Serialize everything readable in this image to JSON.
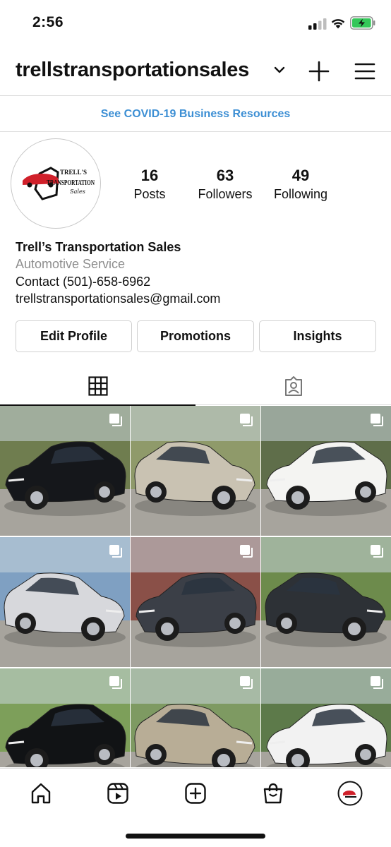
{
  "status_bar": {
    "time": "2:56"
  },
  "header": {
    "username": "trellstransportationsales"
  },
  "banner": {
    "text": "See COVID-19 Business Resources"
  },
  "profile": {
    "stats": [
      {
        "value": "16",
        "label": "Posts"
      },
      {
        "value": "63",
        "label": "Followers"
      },
      {
        "value": "49",
        "label": "Following"
      }
    ],
    "name": "Trell’s Transportation Sales",
    "category": "Automotive Service",
    "contact": "Contact (501)-658-6962",
    "email": "trellstransportationsales@gmail.com",
    "logo_text": {
      "line1": "TRELL'S",
      "line2": "TRANSPORTATION",
      "line3": "Sales"
    }
  },
  "buttons": {
    "edit": "Edit Profile",
    "promotions": "Promotions",
    "insights": "Insights"
  },
  "posts": [
    {
      "car": "black sedan",
      "body": "#15171b",
      "bg": "#6f7d4f"
    },
    {
      "car": "silver sedan",
      "body": "#c9c2b2",
      "bg": "#8f9a6a"
    },
    {
      "car": "white sedan",
      "body": "#f4f4f2",
      "bg": "#5f6e4a"
    },
    {
      "car": "silver sedan",
      "body": "#d7d8dc",
      "bg": "#7fa0c2"
    },
    {
      "car": "gray sedan",
      "body": "#3b3f47",
      "bg": "#8a5048"
    },
    {
      "car": "gray sedan",
      "body": "#2d3136",
      "bg": "#6d8b4c"
    },
    {
      "car": "black sedan",
      "body": "#111315",
      "bg": "#7d9f5a"
    },
    {
      "car": "gold sedan",
      "body": "#b8ad96",
      "bg": "#7e9a62"
    },
    {
      "car": "white sedan",
      "body": "#f2f2f2",
      "bg": "#5d7a4a"
    }
  ],
  "colors": {
    "link": "#3d8fd4",
    "secondary_text": "#8e8e8e",
    "battery_green": "#34c759",
    "logo_red": "#d0202a"
  },
  "icons": [
    "signal-icon",
    "wifi-icon",
    "battery-icon",
    "chevron-down-icon",
    "plus-icon",
    "menu-icon",
    "grid-icon",
    "tagged-icon",
    "home-icon",
    "reels-icon",
    "create-icon",
    "shop-icon",
    "profile-avatar-icon"
  ]
}
